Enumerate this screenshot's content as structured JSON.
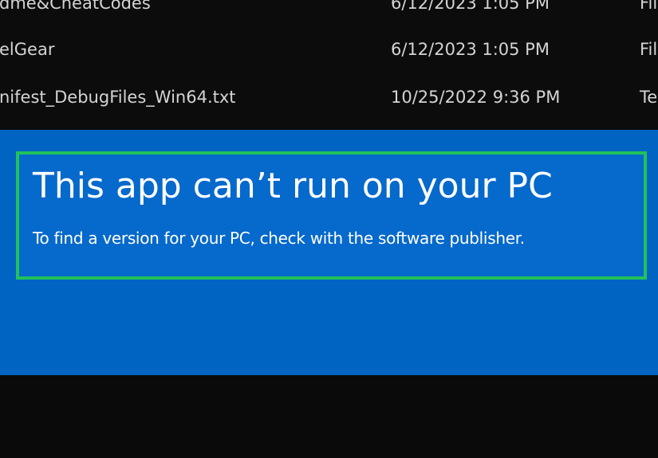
{
  "file_list": {
    "rows": [
      {
        "name": "dme&CheatCodes",
        "date": "6/12/2023 1:05 PM",
        "type": "Fil"
      },
      {
        "name": "elGear",
        "date": "6/12/2023 1:05 PM",
        "type": "Fil"
      },
      {
        "name": "nifest_DebugFiles_Win64.txt",
        "date": "10/25/2022 9:36 PM",
        "type": "Te"
      }
    ]
  },
  "dialog": {
    "title": "This app can’t run on your PC",
    "message": "To find a version for your PC, check with the software publisher."
  },
  "colors": {
    "dialog_background": "#0064c2",
    "highlight_border": "#21c25a",
    "explorer_background": "#0c0c0c"
  }
}
